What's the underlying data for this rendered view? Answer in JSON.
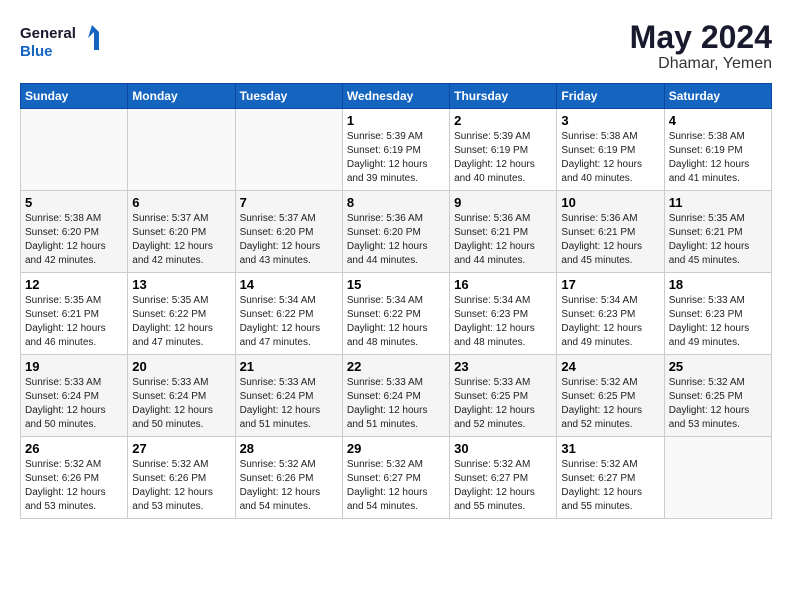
{
  "header": {
    "logo_line1": "General",
    "logo_line2": "Blue",
    "month_year": "May 2024",
    "location": "Dhamar, Yemen"
  },
  "weekdays": [
    "Sunday",
    "Monday",
    "Tuesday",
    "Wednesday",
    "Thursday",
    "Friday",
    "Saturday"
  ],
  "weeks": [
    [
      {
        "day": "",
        "info": ""
      },
      {
        "day": "",
        "info": ""
      },
      {
        "day": "",
        "info": ""
      },
      {
        "day": "1",
        "info": "Sunrise: 5:39 AM\nSunset: 6:19 PM\nDaylight: 12 hours\nand 39 minutes."
      },
      {
        "day": "2",
        "info": "Sunrise: 5:39 AM\nSunset: 6:19 PM\nDaylight: 12 hours\nand 40 minutes."
      },
      {
        "day": "3",
        "info": "Sunrise: 5:38 AM\nSunset: 6:19 PM\nDaylight: 12 hours\nand 40 minutes."
      },
      {
        "day": "4",
        "info": "Sunrise: 5:38 AM\nSunset: 6:19 PM\nDaylight: 12 hours\nand 41 minutes."
      }
    ],
    [
      {
        "day": "5",
        "info": "Sunrise: 5:38 AM\nSunset: 6:20 PM\nDaylight: 12 hours\nand 42 minutes."
      },
      {
        "day": "6",
        "info": "Sunrise: 5:37 AM\nSunset: 6:20 PM\nDaylight: 12 hours\nand 42 minutes."
      },
      {
        "day": "7",
        "info": "Sunrise: 5:37 AM\nSunset: 6:20 PM\nDaylight: 12 hours\nand 43 minutes."
      },
      {
        "day": "8",
        "info": "Sunrise: 5:36 AM\nSunset: 6:20 PM\nDaylight: 12 hours\nand 44 minutes."
      },
      {
        "day": "9",
        "info": "Sunrise: 5:36 AM\nSunset: 6:21 PM\nDaylight: 12 hours\nand 44 minutes."
      },
      {
        "day": "10",
        "info": "Sunrise: 5:36 AM\nSunset: 6:21 PM\nDaylight: 12 hours\nand 45 minutes."
      },
      {
        "day": "11",
        "info": "Sunrise: 5:35 AM\nSunset: 6:21 PM\nDaylight: 12 hours\nand 45 minutes."
      }
    ],
    [
      {
        "day": "12",
        "info": "Sunrise: 5:35 AM\nSunset: 6:21 PM\nDaylight: 12 hours\nand 46 minutes."
      },
      {
        "day": "13",
        "info": "Sunrise: 5:35 AM\nSunset: 6:22 PM\nDaylight: 12 hours\nand 47 minutes."
      },
      {
        "day": "14",
        "info": "Sunrise: 5:34 AM\nSunset: 6:22 PM\nDaylight: 12 hours\nand 47 minutes."
      },
      {
        "day": "15",
        "info": "Sunrise: 5:34 AM\nSunset: 6:22 PM\nDaylight: 12 hours\nand 48 minutes."
      },
      {
        "day": "16",
        "info": "Sunrise: 5:34 AM\nSunset: 6:23 PM\nDaylight: 12 hours\nand 48 minutes."
      },
      {
        "day": "17",
        "info": "Sunrise: 5:34 AM\nSunset: 6:23 PM\nDaylight: 12 hours\nand 49 minutes."
      },
      {
        "day": "18",
        "info": "Sunrise: 5:33 AM\nSunset: 6:23 PM\nDaylight: 12 hours\nand 49 minutes."
      }
    ],
    [
      {
        "day": "19",
        "info": "Sunrise: 5:33 AM\nSunset: 6:24 PM\nDaylight: 12 hours\nand 50 minutes."
      },
      {
        "day": "20",
        "info": "Sunrise: 5:33 AM\nSunset: 6:24 PM\nDaylight: 12 hours\nand 50 minutes."
      },
      {
        "day": "21",
        "info": "Sunrise: 5:33 AM\nSunset: 6:24 PM\nDaylight: 12 hours\nand 51 minutes."
      },
      {
        "day": "22",
        "info": "Sunrise: 5:33 AM\nSunset: 6:24 PM\nDaylight: 12 hours\nand 51 minutes."
      },
      {
        "day": "23",
        "info": "Sunrise: 5:33 AM\nSunset: 6:25 PM\nDaylight: 12 hours\nand 52 minutes."
      },
      {
        "day": "24",
        "info": "Sunrise: 5:32 AM\nSunset: 6:25 PM\nDaylight: 12 hours\nand 52 minutes."
      },
      {
        "day": "25",
        "info": "Sunrise: 5:32 AM\nSunset: 6:25 PM\nDaylight: 12 hours\nand 53 minutes."
      }
    ],
    [
      {
        "day": "26",
        "info": "Sunrise: 5:32 AM\nSunset: 6:26 PM\nDaylight: 12 hours\nand 53 minutes."
      },
      {
        "day": "27",
        "info": "Sunrise: 5:32 AM\nSunset: 6:26 PM\nDaylight: 12 hours\nand 53 minutes."
      },
      {
        "day": "28",
        "info": "Sunrise: 5:32 AM\nSunset: 6:26 PM\nDaylight: 12 hours\nand 54 minutes."
      },
      {
        "day": "29",
        "info": "Sunrise: 5:32 AM\nSunset: 6:27 PM\nDaylight: 12 hours\nand 54 minutes."
      },
      {
        "day": "30",
        "info": "Sunrise: 5:32 AM\nSunset: 6:27 PM\nDaylight: 12 hours\nand 55 minutes."
      },
      {
        "day": "31",
        "info": "Sunrise: 5:32 AM\nSunset: 6:27 PM\nDaylight: 12 hours\nand 55 minutes."
      },
      {
        "day": "",
        "info": ""
      }
    ]
  ]
}
